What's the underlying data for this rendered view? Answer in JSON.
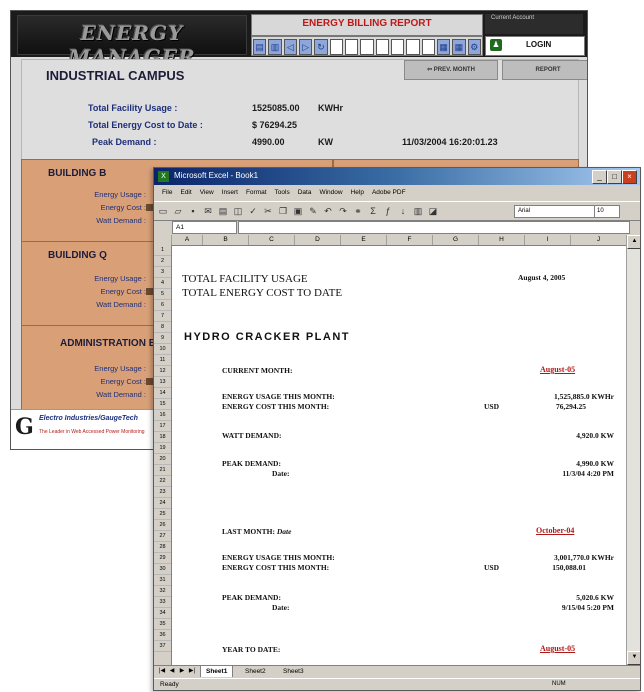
{
  "energy_manager": {
    "logo": "ENERGY MANAGER",
    "report_title": "ENERGY BILLING REPORT",
    "current_account_label": "Current Account",
    "login": "LOGIN",
    "campus_title": "INDUSTRIAL CAMPUS",
    "prev_month_button": "PREV. MONTH",
    "report_button": "REPORT",
    "summary": [
      {
        "label": "Total Facility Usage :",
        "value": "1525085.00",
        "unit": "KWHr",
        "extra": ""
      },
      {
        "label": "Total Energy Cost to Date :",
        "value": "$ 76294.25",
        "unit": "",
        "extra": ""
      },
      {
        "label": "Peak Demand :",
        "value": "4990.00",
        "unit": "KW",
        "extra": "11/03/2004 16:20:01.23"
      }
    ],
    "buildings": [
      {
        "title": "BUILDING B",
        "rows": [
          "Energy Usage :",
          "Energy Cost :",
          "Watt Demand :"
        ]
      },
      {
        "title": "BUILDING Q",
        "rows": [
          "Energy Usage :",
          "Energy Cost :",
          "Watt Demand :"
        ]
      },
      {
        "title": "ADMINISTRATION B",
        "rows": [
          "Energy Usage :",
          "Energy Cost :",
          "Watt Demand :"
        ]
      }
    ],
    "footer_line1": "Electro Industries/GaugeTech",
    "footer_line2": "The Leader in Web Accessed Power Monitoring"
  },
  "excel": {
    "title": "Microsoft Excel - Book1",
    "menu": [
      "File",
      "Edit",
      "View",
      "Insert",
      "Format",
      "Tools",
      "Data",
      "Window",
      "Help",
      "Adobe PDF"
    ],
    "font": "Arial",
    "font_size": "10",
    "name_box": "A1",
    "columns": [
      "A",
      "B",
      "C",
      "D",
      "E",
      "F",
      "G",
      "H",
      "I",
      "J"
    ],
    "rows": [
      "1",
      "2",
      "3",
      "4",
      "5",
      "6",
      "7",
      "8",
      "9",
      "10",
      "11",
      "12",
      "13",
      "14",
      "15",
      "16",
      "17",
      "18",
      "19",
      "20",
      "21",
      "22",
      "23",
      "24",
      "25",
      "26",
      "27",
      "28",
      "29",
      "30",
      "31",
      "32",
      "33",
      "34",
      "35",
      "36",
      "37"
    ],
    "total_facility_usage": "TOTAL FACILITY USAGE",
    "total_energy_cost": "TOTAL ENERGY COST TO DATE",
    "date": "August 4, 2005",
    "plant": "HYDRO CRACKER PLANT",
    "current_month_label": "CURRENT MONTH:",
    "current_month_value": "August-05",
    "cm_usage_label": "ENERGY USAGE THIS MONTH:",
    "cm_usage_value": "1,525,885.0 KWHr",
    "cm_cost_label": "ENERGY COST THIS MONTH:",
    "cm_cost_currency": "USD",
    "cm_cost_value": "76,294.25",
    "watt_demand_label": "WATT DEMAND:",
    "watt_demand_value": "4,920.0 KW",
    "peak_label": "PEAK DEMAND:",
    "peak_value": "4,990.0 KW",
    "date_label": "Date:",
    "peak_date": "11/3/04 4:20 PM",
    "last_month_label": "LAST MONTH:",
    "last_month_note": "Date",
    "last_month_value": "October-04",
    "lm_usage_label": "ENERGY USAGE THIS MONTH:",
    "lm_usage_value": "3,001,770.0 KWHr",
    "lm_cost_label": "ENERGY COST THIS MONTH:",
    "lm_cost_currency": "USD",
    "lm_cost_value": "150,088.01",
    "lm_peak_label": "PEAK DEMAND:",
    "lm_peak_value": "5,020.6 KW",
    "lm_date_label": "Date:",
    "lm_peak_date": "9/15/04 5:20 PM",
    "ytd_label": "YEAR TO DATE:",
    "ytd_value": "August-05",
    "sheets": [
      "Sheet1",
      "Sheet2",
      "Sheet3"
    ],
    "status": "Ready",
    "num": "NUM"
  }
}
